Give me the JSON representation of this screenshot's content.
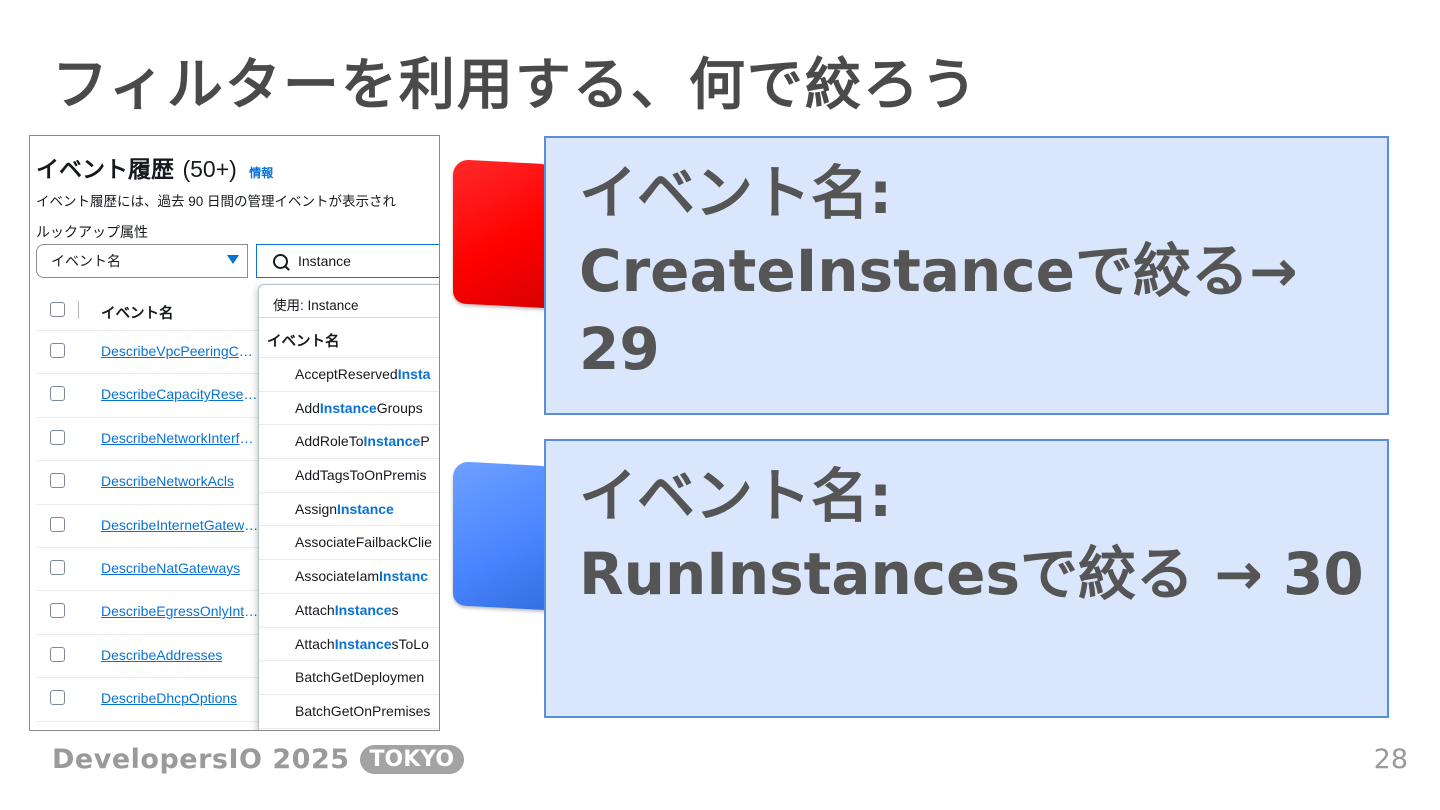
{
  "slide": {
    "title": "フィルターを利用する、何で絞ろう",
    "page_number": "28",
    "footer_brand": "DevelopersIO 2025",
    "footer_badge": "TOKYO"
  },
  "console": {
    "title": "イベント履歴",
    "count": "(50+)",
    "info_link": "情報",
    "description": "イベント履歴には、過去 90 日間の管理イベントが表示され",
    "lookup_label": "ルックアップ属性",
    "attribute_select": "イベント名",
    "search_value": "Instance",
    "table": {
      "column_header": "イベント名",
      "rows": [
        "DescribeVpcPeeringConnections",
        "DescribeCapacityReservations",
        "DescribeNetworkInterfaces",
        "DescribeNetworkAcls",
        "DescribeInternetGateways",
        "DescribeNatGateways",
        "DescribeEgressOnlyInternetGateways",
        "DescribeAddresses",
        "DescribeDhcpOptions"
      ]
    },
    "dropdown": {
      "used_label": "使用: Instance",
      "group_label": "イベント名",
      "items": [
        {
          "pre": "AcceptReserved",
          "match": "Insta",
          "post": ""
        },
        {
          "pre": "Add",
          "match": "Instance",
          "post": "Groups"
        },
        {
          "pre": "AddRoleTo",
          "match": "Instance",
          "post": "P"
        },
        {
          "pre": "AddTagsToOnPremis",
          "match": "",
          "post": ""
        },
        {
          "pre": "Assign",
          "match": "Instance",
          "post": ""
        },
        {
          "pre": "AssociateFailbackClie",
          "match": "",
          "post": ""
        },
        {
          "pre": "AssociateIam",
          "match": "Instanc",
          "post": ""
        },
        {
          "pre": "Attach",
          "match": "Instance",
          "post": "s"
        },
        {
          "pre": "Attach",
          "match": "Instance",
          "post": "sToLo"
        },
        {
          "pre": "BatchGetDeploymen",
          "match": "",
          "post": ""
        },
        {
          "pre": "BatchGetOnPremises",
          "match": "",
          "post": ""
        }
      ]
    }
  },
  "callouts": [
    {
      "marker_color": "#ff0000",
      "lines": [
        "イベント名:",
        "CreateInstanceで絞る→",
        "29"
      ]
    },
    {
      "marker_color": "#4a86ff",
      "lines": [
        "イベント名:",
        "RunInstancesで絞る → 30"
      ]
    }
  ]
}
